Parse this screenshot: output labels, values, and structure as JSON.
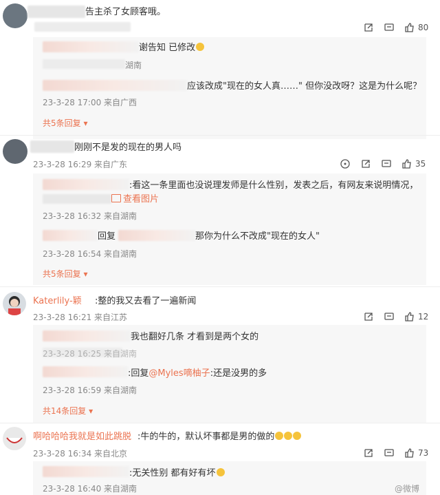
{
  "comments": [
    {
      "text": "告主杀了女顾客哦。",
      "likes": "80",
      "replies": [
        {
          "text": "谢告知 已修改"
        },
        {
          "meta": "湖南"
        },
        {
          "text": "应该改成\"现在的女人真……\" 但你没改呀？这是为什么呢？",
          "meta": "23-3-28 17:00 来自广西"
        }
      ],
      "more": "共5条回复"
    },
    {
      "text": "刚刚不是发的现在的男人吗",
      "meta": "23-3-28 16:29 来自广东",
      "likes": "35",
      "replies": [
        {
          "text": ":看这一条里面也没说理发师是什么性别，发表之后，有网友来说明情况，",
          "link": "查看图片",
          "meta": "23-3-28 16:32 来自湖南"
        },
        {
          "prefix": "回复",
          "text": "那你为什么不改成\"现在的女人\"",
          "meta": "23-3-28 16:54 来自湖南"
        }
      ],
      "more": "共5条回复"
    },
    {
      "user": "Katerlily-颖",
      "text": ":整的我又去看了一遍新闻",
      "meta": "23-3-28 16:21 来自江苏",
      "likes": "12",
      "replies": [
        {
          "text": "我也翻好几条 才看到是两个女的",
          "meta": "23-3-28 16:25 来自湖南"
        },
        {
          "prefix": ":回复",
          "mention": "@Myles嘀柚子",
          "text": ":还是没男的多",
          "meta": "23-3-28 16:59 来自湖南"
        }
      ],
      "more": "共14条回复"
    },
    {
      "user": "啊哈哈哈我就是如此跳脱",
      "text": ":牛的牛的，默认坏事都是男的做的",
      "meta": "23-3-28 16:34 来自北京",
      "likes": "73",
      "replies": [
        {
          "text": ":无关性别 都有好有坏",
          "meta": "23-3-28 16:40 来自湖南"
        }
      ]
    }
  ],
  "watermark": "@微博",
  "colors": {
    "link": "#eb7350",
    "emoji": "#f5c33b"
  }
}
